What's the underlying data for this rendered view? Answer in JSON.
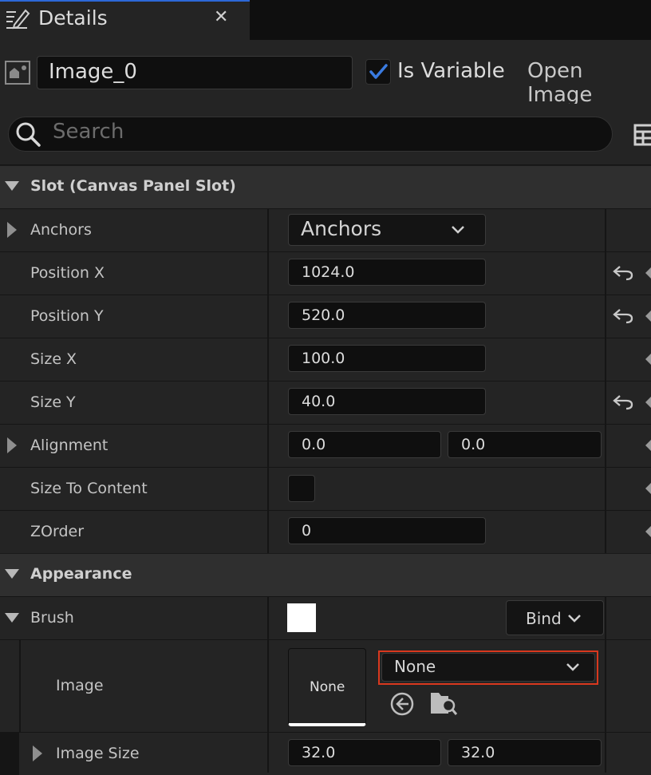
{
  "tab": {
    "title": "Details",
    "close": "✕"
  },
  "header": {
    "name_value": "Image_0",
    "is_variable_label": "Is Variable",
    "is_variable_checked": true,
    "open_image_label": "Open Image"
  },
  "search": {
    "placeholder": "Search"
  },
  "sections": {
    "slot": "Slot (Canvas Panel Slot)",
    "appearance": "Appearance"
  },
  "slot": {
    "anchors_label": "Anchors",
    "anchors_value": "Anchors",
    "position_x_label": "Position X",
    "position_x": "1024.0",
    "position_y_label": "Position Y",
    "position_y": "520.0",
    "size_x_label": "Size X",
    "size_x": "100.0",
    "size_y_label": "Size Y",
    "size_y": "40.0",
    "alignment_label": "Alignment",
    "alignment_x": "0.0",
    "alignment_y": "0.0",
    "size_to_content_label": "Size To Content",
    "zorder_label": "ZOrder",
    "zorder": "0"
  },
  "appearance": {
    "brush_label": "Brush",
    "bind_label": "Bind",
    "image_label": "Image",
    "image_thumb_text": "None",
    "image_combo_value": "None",
    "image_size_label": "Image Size",
    "image_size_x": "32.0",
    "image_size_y": "32.0"
  },
  "colors": {
    "accent": "#2d68d8",
    "highlight": "#d9381e",
    "brush_color": "#ffffff"
  },
  "icons": [
    "details-pencil-icon",
    "close-icon",
    "widget-icon",
    "checkmark-icon",
    "search-icon",
    "table-view-icon",
    "collapse-arrow-icon",
    "expand-arrow-icon",
    "chevron-down-icon",
    "reset-arrow-icon",
    "keyframe-diamond-icon",
    "use-selected-arrow-icon",
    "browse-folder-icon"
  ]
}
